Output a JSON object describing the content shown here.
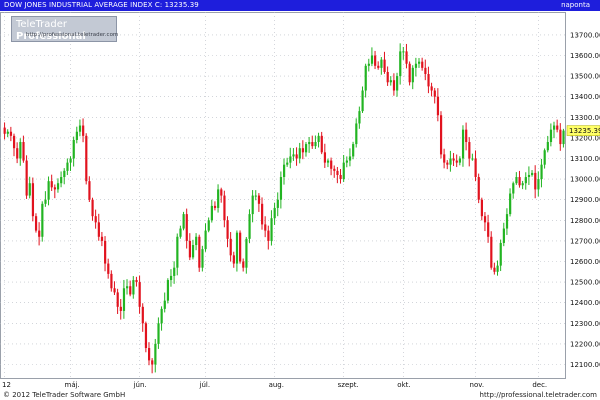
{
  "header": {
    "title": "DOW JONES INDUSTRIAL AVERAGE INDEX  C: 13235.39",
    "period": "naponta"
  },
  "logo": {
    "brand_prefix": "TeleTrader ",
    "brand_bold": "Professional",
    "url": "http://professional.teletrader.com"
  },
  "footer": {
    "copyright": "© 2012 TeleTrader Software GmbH",
    "url": "http://professional.teletrader.com"
  },
  "colors": {
    "up": "#22b422",
    "down": "#e1121e",
    "frame": "#1e1edc",
    "last_price_bg": "#ffff66"
  },
  "chart_data": {
    "type": "candlestick",
    "title": "DOW JONES INDUSTRIAL AVERAGE INDEX",
    "last_close_label": "13235.39",
    "last_close": 13235.39,
    "ylim": [
      12000,
      13800
    ],
    "y_ticks": [
      12100,
      12200,
      12300,
      12400,
      12500,
      12600,
      12700,
      12800,
      12900,
      13000,
      13100,
      13200,
      13300,
      13400,
      13500,
      13600,
      13700
    ],
    "y_tick_labels": [
      "12100.00",
      "12200.00",
      "12300.00",
      "12400.00",
      "12500.00",
      "12600.00",
      "12700.00",
      "12800.00",
      "12900.00",
      "13000.00",
      "13100.00",
      "13200.00",
      "13300.00",
      "13400.00",
      "13500.00",
      "13600.00",
      "13700.00"
    ],
    "x_labels": [
      "12",
      "máj.",
      "jún.",
      "júl.",
      "aug.",
      "szept.",
      "okt.",
      "nov.",
      "dec."
    ],
    "x_label_sessions": [
      0,
      21,
      43,
      64,
      86,
      108,
      127,
      150,
      170
    ],
    "grid": true,
    "close": [
      13220,
      13230,
      13210,
      13150,
      13100,
      13180,
      13090,
      12920,
      12980,
      12820,
      12750,
      12720,
      12880,
      12900,
      12990,
      12960,
      12950,
      12980,
      13010,
      13040,
      13080,
      13100,
      13190,
      13230,
      13260,
      13210,
      12990,
      12900,
      12820,
      12790,
      12720,
      12700,
      12590,
      12540,
      12470,
      12450,
      12380,
      12360,
      12470,
      12480,
      12440,
      12510,
      12500,
      12380,
      12300,
      12180,
      12120,
      12100,
      12200,
      12300,
      12370,
      12410,
      12510,
      12530,
      12570,
      12720,
      12760,
      12830,
      12700,
      12620,
      12680,
      12720,
      12570,
      12660,
      12750,
      12800,
      12870,
      12860,
      12950,
      12920,
      12800,
      12710,
      12630,
      12590,
      12740,
      12600,
      12570,
      12710,
      12830,
      12920,
      12920,
      12880,
      12780,
      12750,
      12700,
      12810,
      12860,
      12900,
      13010,
      13070,
      13080,
      13110,
      13120,
      13100,
      13150,
      13130,
      13170,
      13180,
      13160,
      13180,
      13210,
      13130,
      13080,
      13090,
      13050,
      13040,
      13020,
      13000,
      13080,
      13090,
      13110,
      13170,
      13270,
      13330,
      13430,
      13550,
      13560,
      13600,
      13550,
      13540,
      13580,
      13520,
      13470,
      13480,
      13430,
      13500,
      13620,
      13620,
      13560,
      13470,
      13540,
      13560,
      13570,
      13540,
      13510,
      13450,
      13430,
      13400,
      13310,
      13120,
      13080,
      13070,
      13100,
      13090,
      13080,
      13100,
      13240,
      13180,
      13100,
      13100,
      13010,
      12900,
      12820,
      12790,
      12720,
      12570,
      12550,
      12580,
      12690,
      12760,
      12830,
      12930,
      12980,
      13010,
      12970,
      12980,
      13010,
      13020,
      13030,
      12950,
      13000,
      13070,
      13140,
      13180,
      13240,
      13260,
      13240,
      13170,
      13235.39
    ],
    "open": 13250
  }
}
